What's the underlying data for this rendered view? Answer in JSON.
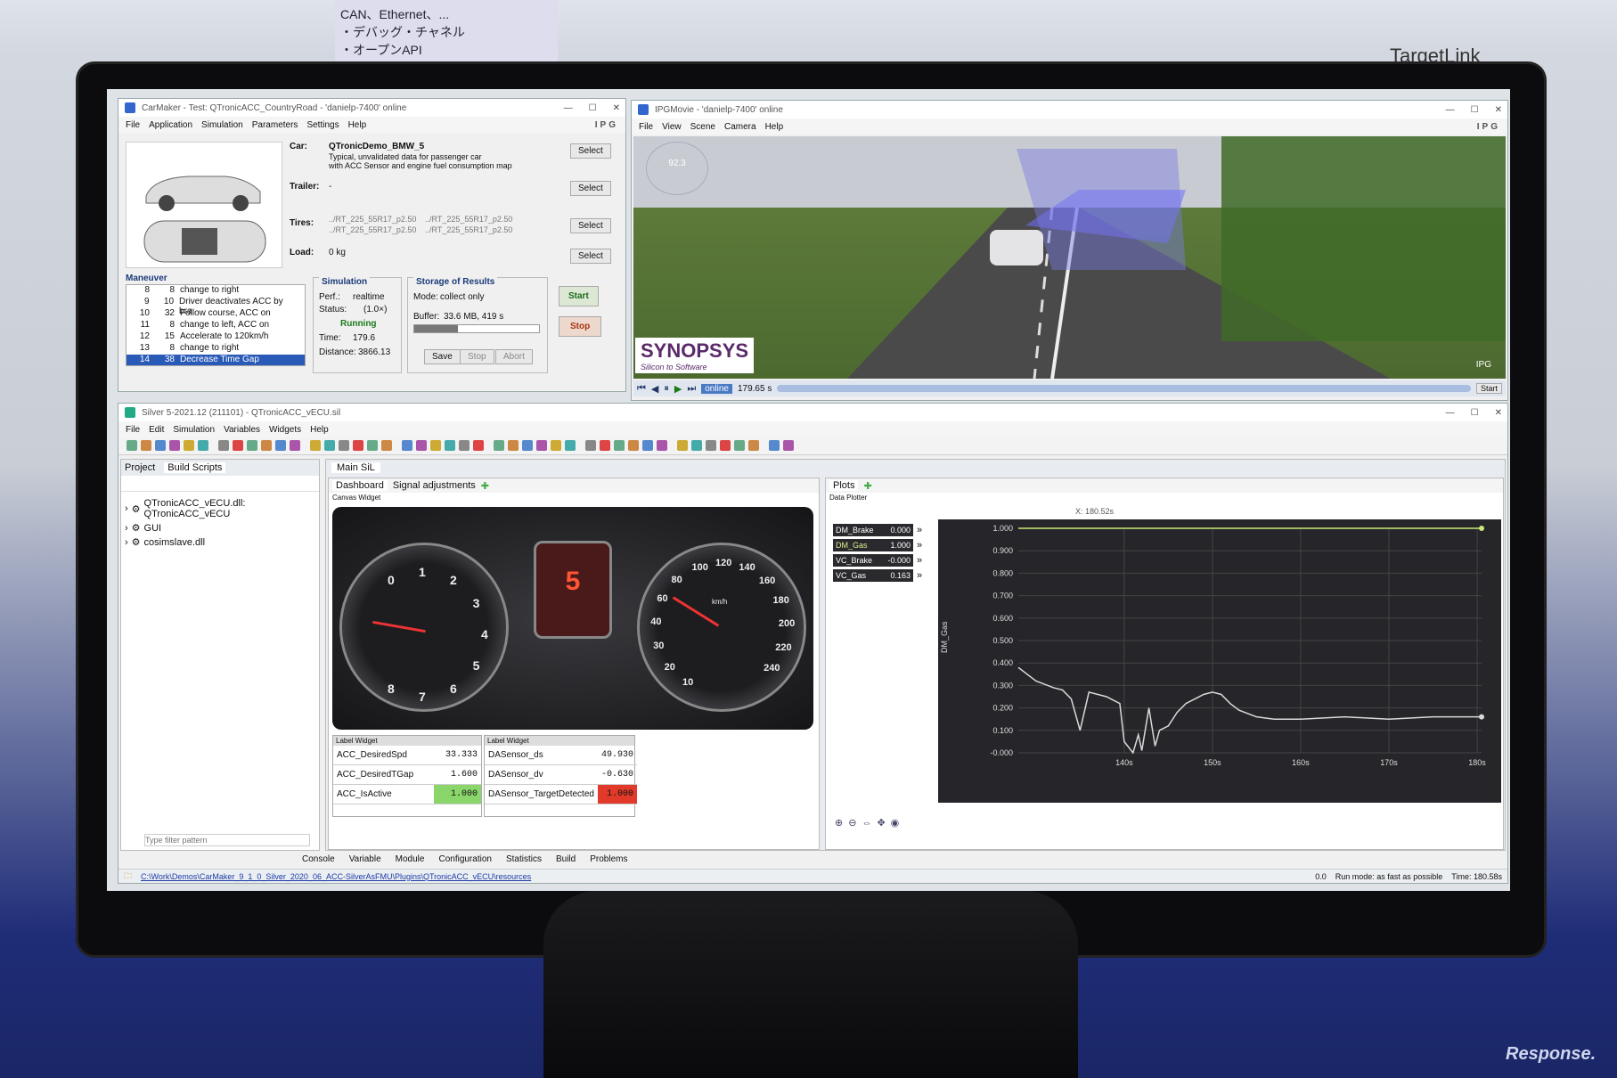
{
  "backdrop": {
    "banner_left": "CAN、Ethernet、...\n・デバッグ・チャネル\n・オープンAPI",
    "watermark": "Response.",
    "brand_label": "TargetLink"
  },
  "carmaker": {
    "title": "CarMaker - Test: QTronicACC_CountryRoad - 'danielp-7400' online",
    "menu": [
      "File",
      "Application",
      "Simulation",
      "Parameters",
      "Settings",
      "Help"
    ],
    "brand": "IPG",
    "car_label": "Car:",
    "car_name": "QTronicDemo_BMW_5",
    "car_desc1": "Typical, unvalidated data for passenger car",
    "car_desc2": "with ACC Sensor and engine fuel consumption map",
    "trailer_label": "Trailer:",
    "trailer_value": "-",
    "tires_label": "Tires:",
    "tires": [
      "../RT_225_55R17_p2.50",
      "../RT_225_55R17_p2.50",
      "../RT_225_55R17_p2.50",
      "../RT_225_55R17_p2.50"
    ],
    "load_label": "Load:",
    "load_value": "0 kg",
    "select_label": "Select",
    "maneuver_title": "Maneuver",
    "maneuvers": [
      {
        "n": "8",
        "t": "8",
        "desc": "change to right"
      },
      {
        "n": "9",
        "t": "10",
        "desc": "Driver deactivates ACC by bra"
      },
      {
        "n": "10",
        "t": "32",
        "desc": "Follow course, ACC on"
      },
      {
        "n": "11",
        "t": "8",
        "desc": "change to left, ACC on"
      },
      {
        "n": "12",
        "t": "15",
        "desc": "Accelerate to 120km/h"
      },
      {
        "n": "13",
        "t": "8",
        "desc": "change to right"
      },
      {
        "n": "14",
        "t": "38",
        "desc": "Decrease Time Gap"
      }
    ],
    "sim_title": "Simulation",
    "perf_label": "Perf.:",
    "perf_value": "realtime",
    "status_label": "Status:",
    "status_value": "(1.0×)",
    "running": "Running",
    "time_label": "Time:",
    "time_value": "179.6",
    "distance_label": "Distance:",
    "distance_value": "3866.13",
    "storage_title": "Storage of Results",
    "mode_label": "Mode:",
    "mode_value": "collect only",
    "buffer_label": "Buffer:",
    "buffer_value": "33.6 MB, 419 s",
    "buffer_fill": 0.35,
    "save": "Save",
    "stop_small": "Stop",
    "abort": "Abort",
    "start": "Start",
    "stop": "Stop"
  },
  "ipgmovie": {
    "title": "IPGMovie - 'danielp-7400' online",
    "menu": [
      "File",
      "View",
      "Scene",
      "Camera",
      "Help"
    ],
    "brand": "IPG",
    "logo": "SYNOPSYS",
    "logo_sub": "Silicon to Software",
    "online": "online",
    "time": "179.65 s",
    "start": "Start",
    "overlay_speed": "92.3",
    "ipg_small": "IPG"
  },
  "silver": {
    "title": "Silver 5-2021.12 (211101) - QTronicACC_vECU.sil",
    "menu": [
      "File",
      "Edit",
      "Simulation",
      "Variables",
      "Widgets",
      "Help"
    ],
    "tabs_left": [
      "Project",
      "Build Scripts"
    ],
    "tree": [
      "QTronicACC_vECU.dll: QTronicACC_vECU",
      "GUI",
      "cosimslave.dll"
    ],
    "filter_placeholder": "Type filter pattern",
    "main_tab": "Main SiL",
    "dash_tabs": [
      "Dashboard",
      "Signal adjustments"
    ],
    "canvas_title": "Canvas Widget",
    "gear": "5",
    "rpm_ticks": [
      "0",
      "1",
      "2",
      "3",
      "4",
      "5",
      "6",
      "7",
      "8"
    ],
    "speed_ticks": [
      "10",
      "20",
      "30",
      "40",
      "60",
      "80",
      "100",
      "120",
      "140",
      "160",
      "180",
      "200",
      "220",
      "240"
    ],
    "speed_unit": "km/h",
    "label_widget": "Label Widget",
    "labels_left": [
      {
        "name": "ACC_DesiredSpd",
        "value": "33.333"
      },
      {
        "name": "ACC_DesiredTGap",
        "value": "1.600"
      },
      {
        "name": "ACC_IsActive",
        "value": "1.000"
      }
    ],
    "labels_right": [
      {
        "name": "DASensor_ds",
        "value": "49.930"
      },
      {
        "name": "DASensor_dv",
        "value": "-0.630"
      },
      {
        "name": "DASensor_TargetDetected",
        "value": "1.000"
      }
    ],
    "plots_tab": "Plots",
    "plotter_title": "Data Plotter",
    "cursor": "X: 180.52s",
    "vars": [
      {
        "name": "DM_Brake",
        "value": "0.000"
      },
      {
        "name": "DM_Gas",
        "value": "1.000"
      },
      {
        "name": "VC_Brake",
        "value": "-0.000"
      },
      {
        "name": "VC_Gas",
        "value": "0.163"
      }
    ],
    "bottom_tabs": [
      "Console",
      "Variable",
      "Module",
      "Configuration",
      "Statistics",
      "Build",
      "Problems"
    ],
    "path": "C:\\Work\\Demos\\CarMaker_9_1_0_Silver_2020_06_ACC-SilverAsFMU\\Plugins\\QTronicACC_vECU\\resources",
    "status_value": "0.0",
    "run_mode": "Run mode: as fast as possible",
    "time_status": "Time: 180.58s"
  },
  "chart_data": {
    "type": "line",
    "ylabel": "DM_Gas",
    "xlabel": "",
    "ylim": [
      -0.0,
      1.0
    ],
    "yticks": [
      "1.000",
      "0.900",
      "0.800",
      "0.700",
      "0.600",
      "0.500",
      "0.400",
      "0.300",
      "0.200",
      "0.100",
      "-0.000"
    ],
    "xticks": [
      "140s",
      "150s",
      "160s",
      "170s",
      "180s"
    ],
    "xlim": [
      128,
      180.5
    ],
    "series": [
      {
        "name": "DM_Gas",
        "color": "#c9e87a",
        "x": [
          128,
          180.5
        ],
        "y": [
          1.0,
          1.0
        ]
      },
      {
        "name": "VC_Gas",
        "color": "#d9d9d9",
        "x": [
          128,
          130,
          132,
          133,
          134,
          135,
          136,
          138,
          138.5,
          139.5,
          140,
          141,
          141.6,
          142,
          142.8,
          143.5,
          144,
          145,
          146,
          147,
          148,
          149,
          150,
          151,
          152,
          153,
          155,
          157,
          160,
          165,
          170,
          175,
          180.5
        ],
        "y": [
          0.38,
          0.32,
          0.29,
          0.28,
          0.24,
          0.1,
          0.27,
          0.25,
          0.24,
          0.22,
          0.05,
          0.0,
          0.08,
          0.01,
          0.2,
          0.03,
          0.1,
          0.12,
          0.18,
          0.22,
          0.24,
          0.26,
          0.27,
          0.26,
          0.22,
          0.19,
          0.16,
          0.15,
          0.15,
          0.16,
          0.15,
          0.16,
          0.16
        ]
      }
    ]
  }
}
